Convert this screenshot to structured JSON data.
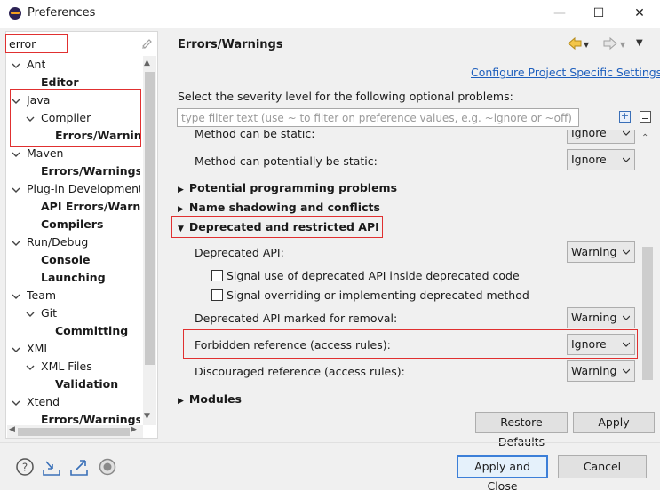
{
  "window": {
    "title": "Preferences",
    "minimize": "—",
    "maximize": "☐",
    "close": "✕"
  },
  "filter": {
    "value": "error"
  },
  "tree": [
    {
      "label": "Ant",
      "bold": false,
      "expanded": true
    },
    {
      "label": "Editor",
      "bold": true
    },
    {
      "label": "Java",
      "bold": false,
      "expanded": true
    },
    {
      "label": "Compiler",
      "bold": false,
      "expanded": true
    },
    {
      "label": "Errors/Warning",
      "bold": true,
      "selected": true
    },
    {
      "label": "Maven",
      "bold": false,
      "expanded": true
    },
    {
      "label": "Errors/Warnings",
      "bold": true
    },
    {
      "label": "Plug-in Development",
      "bold": false,
      "expanded": true
    },
    {
      "label": "API Errors/Warnin",
      "bold": true
    },
    {
      "label": "Compilers",
      "bold": true
    },
    {
      "label": "Run/Debug",
      "bold": false,
      "expanded": true
    },
    {
      "label": "Console",
      "bold": true
    },
    {
      "label": "Launching",
      "bold": true
    },
    {
      "label": "Team",
      "bold": false,
      "expanded": true
    },
    {
      "label": "Git",
      "bold": false,
      "expanded": true
    },
    {
      "label": "Committing",
      "bold": true
    },
    {
      "label": "XML",
      "bold": false,
      "expanded": true
    },
    {
      "label": "XML Files",
      "bold": false,
      "expanded": true
    },
    {
      "label": "Validation",
      "bold": true
    },
    {
      "label": "Xtend",
      "bold": false,
      "expanded": true
    },
    {
      "label": "Errors/Warnings",
      "bold": true
    }
  ],
  "page": {
    "title": "Errors/Warnings",
    "config_link": "Configure Project Specific Settings...",
    "severity_prompt": "Select the severity level for the following optional problems:",
    "filter_placeholder": "type filter text (use ~ to filter on preference values, e.g. ~ignore or ~off)"
  },
  "options": {
    "method_static": {
      "label": "Method can be static:",
      "value": "Ignore"
    },
    "method_potential_static": {
      "label": "Method can potentially be static:",
      "value": "Ignore"
    },
    "section_potential": "Potential programming problems",
    "section_naming": "Name shadowing and conflicts",
    "section_deprecated": "Deprecated and restricted API",
    "deprecated_api": {
      "label": "Deprecated API:",
      "value": "Warning"
    },
    "chk_signal_use": "Signal use of deprecated API inside deprecated code",
    "chk_signal_override": "Signal overriding or implementing deprecated method",
    "deprecated_removal": {
      "label": "Deprecated API marked for removal:",
      "value": "Warning"
    },
    "forbidden_ref": {
      "label": "Forbidden reference (access rules):",
      "value": "Ignore"
    },
    "discouraged_ref": {
      "label": "Discouraged reference (access rules):",
      "value": "Warning"
    },
    "section_modules": "Modules"
  },
  "buttons": {
    "restore_defaults": "Restore Defaults",
    "apply": "Apply",
    "apply_and_close": "Apply and Close",
    "cancel": "Cancel"
  },
  "icons": [
    "help-icon",
    "import-icon",
    "export-icon",
    "record-icon",
    "back-icon",
    "forward-icon",
    "menu-icon",
    "expand-all-icon",
    "collapse-all-icon"
  ],
  "colors": {
    "highlight": "#e03030",
    "link": "#1e5fbd",
    "primary_button_border": "#3c7fd8"
  }
}
